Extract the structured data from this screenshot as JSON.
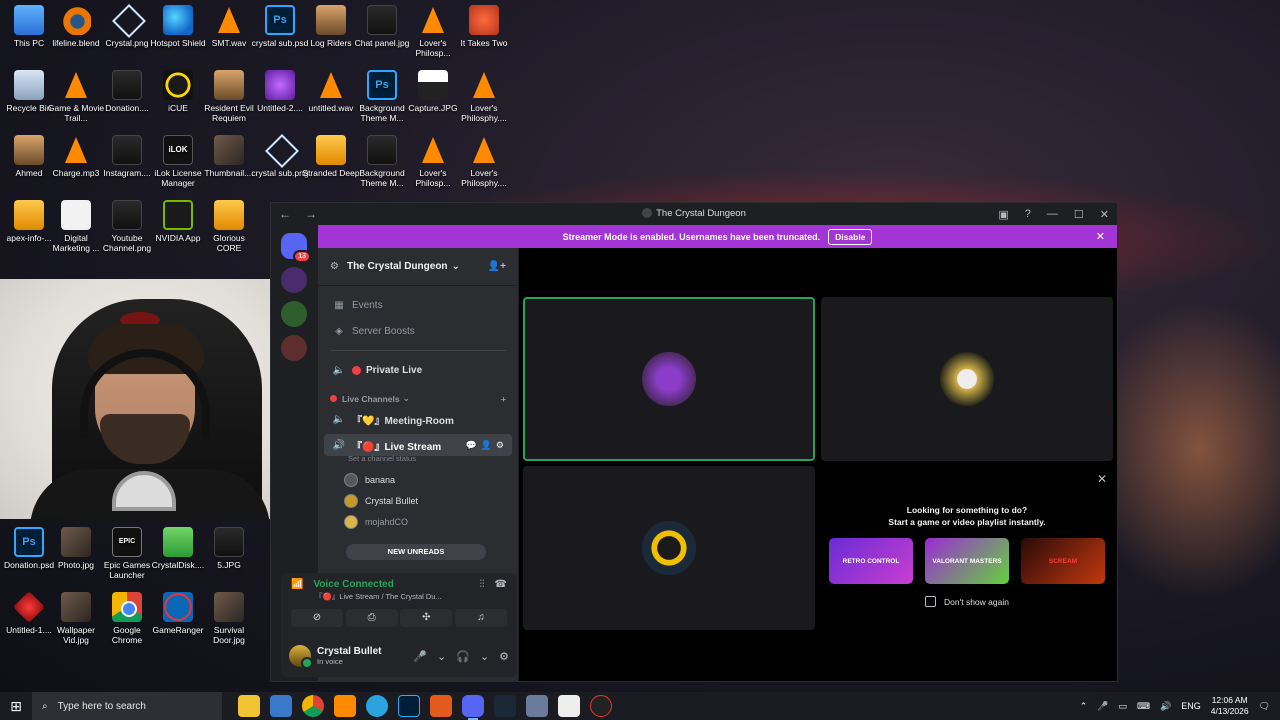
{
  "desktop": {
    "icons": [
      {
        "label": "This PC"
      },
      {
        "label": "lifeline.blend"
      },
      {
        "label": "Crystal.png"
      },
      {
        "label": "Hotspot Shield"
      },
      {
        "label": "SMT.wav"
      },
      {
        "label": "crystal sub.psd"
      },
      {
        "label": "Log Riders"
      },
      {
        "label": "Chat panel.jpg"
      },
      {
        "label": "Lover's Philosp..."
      },
      {
        "label": "It Takes Two"
      },
      {
        "label": "Recycle Bin"
      },
      {
        "label": "Game & Movie Trail..."
      },
      {
        "label": "Donation...."
      },
      {
        "label": "iCUE"
      },
      {
        "label": "Resident Evil Requiem"
      },
      {
        "label": "Untitled-2...."
      },
      {
        "label": "untitled.wav"
      },
      {
        "label": "Background Theme M..."
      },
      {
        "label": "Capture.JPG"
      },
      {
        "label": "Lover's Philosphy...."
      },
      {
        "label": "Ahmed"
      },
      {
        "label": "Charge.mp3"
      },
      {
        "label": "Instagram...."
      },
      {
        "label": "iLok License Manager"
      },
      {
        "label": "Thumbnail...."
      },
      {
        "label": "crystal sub.png"
      },
      {
        "label": "Stranded Deep"
      },
      {
        "label": "Background Theme M..."
      },
      {
        "label": "Lover's Philosp..."
      },
      {
        "label": "Lover's Philosphy...."
      },
      {
        "label": "apex-info-..."
      },
      {
        "label": "Digital Marketing ..."
      },
      {
        "label": "Youtube Channel.png"
      },
      {
        "label": "NVIDIA App"
      },
      {
        "label": "Glorious CORE"
      },
      {
        "label": "Donation.psd"
      },
      {
        "label": "Photo.jpg"
      },
      {
        "label": "Epic Games Launcher"
      },
      {
        "label": "CrystalDisk...."
      },
      {
        "label": "5.JPG"
      },
      {
        "label": "Untitled-1...."
      },
      {
        "label": "Wallpaper Vid.jpg"
      },
      {
        "label": "Google Chrome"
      },
      {
        "label": "GameRanger"
      },
      {
        "label": "Survival Door.jpg"
      }
    ]
  },
  "discord": {
    "window_title": "The Crystal Dungeon",
    "nav_back": "←",
    "nav_forward": "→",
    "controls": {
      "minimize": "—",
      "maximize": "☐",
      "close": "✕",
      "inbox": "▣",
      "help": "?"
    },
    "banner": {
      "text": "Streamer Mode is enabled. Usernames have been truncated.",
      "button": "Disable",
      "close": "✕"
    },
    "guild_badge": "13",
    "server": {
      "name": "The Crystal Dungeon"
    },
    "channels": {
      "events": "Events",
      "boosts": "Server Boosts",
      "private_live": "Private Live",
      "category": "Live Channels",
      "meeting": "『💛』Meeting-Room",
      "live_stream": "『🔴』Live Stream",
      "status_hint": "Set a channel status",
      "users": [
        "banana",
        "Crystal Bullet",
        "mojahdCO"
      ],
      "new_unreads": "NEW UNREADS"
    },
    "voice": {
      "connected": "Voice Connected",
      "location": "『🔴』Live Stream / The Crystal Du..."
    },
    "user": {
      "name": "Crystal Bullet",
      "status": "In voice"
    },
    "suggest": {
      "line1": "Looking for something to do?",
      "line2": "Start a game or video playlist instantly.",
      "games": [
        "RETRO CONTROL",
        "VALORANT MASTERS",
        "SCREAM"
      ],
      "dont_show": "Don't show again",
      "close": "✕"
    }
  },
  "taskbar": {
    "search_placeholder": "Type here to search",
    "lang": "ENG",
    "time": "12:06 AM",
    "date": "4/13/2026"
  },
  "colors": {
    "accent": "#a335d6",
    "voice_green": "#23a55a",
    "blurple": "#5865f2",
    "danger": "#f23f43"
  }
}
